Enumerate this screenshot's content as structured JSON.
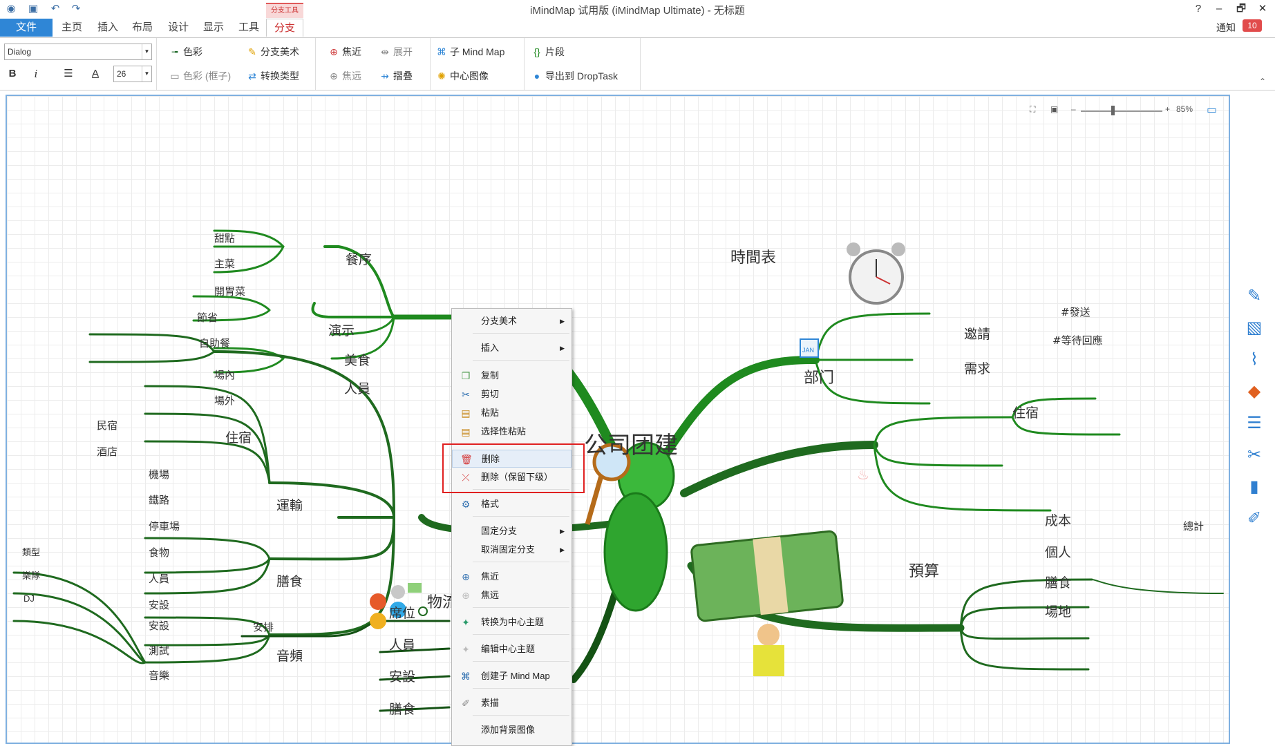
{
  "window": {
    "title": "iMindMap 试用版 (iMindMap Ultimate) - 无标题",
    "help": "?",
    "minimize": "–",
    "restore": "🗗",
    "close": "✕"
  },
  "quick_access": [
    "app-logo-icon",
    "save-icon",
    "undo-icon",
    "redo-icon"
  ],
  "tabs": {
    "file": "文件",
    "home": "主页",
    "insert": "插入",
    "layout": "布局",
    "design": "设计",
    "view": "显示",
    "tools": "工具",
    "branch": "分支",
    "contextual_group": "分支工具"
  },
  "notifications": {
    "label": "通知",
    "count": "10"
  },
  "ribbon": {
    "font_name": "Dialog",
    "font_size": "26",
    "bold": "B",
    "italic": "i",
    "color": "色彩",
    "color_box": "色彩 (框子)",
    "branch_art": "分支美术",
    "convert_type": "转换类型",
    "focus_in": "焦近",
    "focus_out": "焦远",
    "expand": "展开",
    "collapse": "摺叠",
    "sub_mindmap": "子 Mind Map",
    "central_image": "中心图像",
    "snippet": "片段",
    "export_droptask": "导出到 DropTask"
  },
  "zoom": {
    "level": "85%"
  },
  "map": {
    "central": "公司团建",
    "branches": {
      "food": "膳食",
      "food_children": [
        "餐序",
        "演示",
        "美食",
        "人員"
      ],
      "food_leaves": [
        "甜點",
        "主菜",
        "開胃菜",
        "節省",
        "自助餐",
        "場內",
        "場外"
      ],
      "logistics": "物流",
      "logistics_children": [
        "住宿",
        "運輸",
        "膳食",
        "音頻"
      ],
      "logistics_leaves": [
        "民宿",
        "酒店",
        "機場",
        "鐵路",
        "停車場",
        "食物",
        "人員",
        "安設",
        "安設",
        "測試",
        "音樂",
        "類型",
        "樂隊",
        "DJ"
      ],
      "schedule": "時間表",
      "departments": "部门",
      "dept_children": [
        "邀請",
        "需求",
        "住宿"
      ],
      "dept_leaves": [
        "#發送",
        "#等待回應"
      ],
      "budget": "預算",
      "budget_children": [
        "成本",
        "個人",
        "膳食",
        "場地"
      ],
      "budget_leaves": [
        "總計"
      ],
      "venue": "場地",
      "venue_children": [
        "席位",
        "人員",
        "安設",
        "膳食"
      ],
      "venue_leaves": [
        "安排"
      ]
    }
  },
  "context_menu": {
    "items": [
      {
        "label": "分支美术",
        "icon": "",
        "submenu": true
      },
      {
        "label": "插入",
        "icon": "",
        "submenu": true
      },
      {
        "label": "复制",
        "icon": "copy-icon",
        "submenu": false
      },
      {
        "label": "剪切",
        "icon": "scissors-icon",
        "submenu": false
      },
      {
        "label": "粘贴",
        "icon": "paste-icon",
        "submenu": false
      },
      {
        "label": "选择性粘贴",
        "icon": "paste-special-icon",
        "submenu": false
      },
      {
        "label": "删除",
        "icon": "trash-icon",
        "submenu": false
      },
      {
        "label": "删除（保留下级）",
        "icon": "delete-keep-children-icon",
        "submenu": false
      },
      {
        "label": "格式",
        "icon": "format-icon",
        "submenu": false
      },
      {
        "label": "固定分支",
        "icon": "",
        "submenu": true
      },
      {
        "label": "取消固定分支",
        "icon": "",
        "submenu": true
      },
      {
        "label": "焦近",
        "icon": "focus-in-icon",
        "submenu": false
      },
      {
        "label": "焦远",
        "icon": "focus-out-icon",
        "submenu": false
      },
      {
        "label": "转换为中心主题",
        "icon": "convert-central-icon",
        "submenu": false
      },
      {
        "label": "编辑中心主题",
        "icon": "edit-central-icon",
        "submenu": false
      },
      {
        "label": "创建子 Mind Map",
        "icon": "sub-mindmap-icon",
        "submenu": false
      },
      {
        "label": "素描",
        "icon": "sketch-icon",
        "submenu": false
      },
      {
        "label": "添加背景图像",
        "icon": "",
        "submenu": false
      }
    ]
  },
  "colors": {
    "branch_green": "#1f8a1f",
    "dark_green": "#0d5a0d",
    "accent_blue": "#2f86d6",
    "highlight_red": "#e02020"
  }
}
